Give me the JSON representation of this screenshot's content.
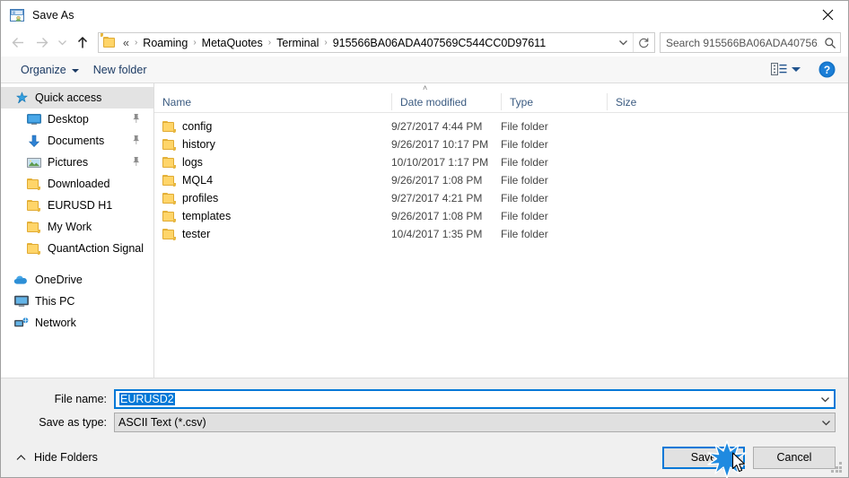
{
  "window": {
    "title": "Save As",
    "icon": "save-as-icon",
    "close_label": "Close"
  },
  "nav": {
    "back": "back-arrow-icon",
    "forward": "forward-arrow-icon",
    "recent": "recent-locations-icon",
    "up": "up-arrow-icon"
  },
  "address": {
    "folder_icon": "folder-icon",
    "prefix": "«",
    "crumbs": [
      "Roaming",
      "MetaQuotes",
      "Terminal",
      "915566BA06ADA407569C544CC0D97611"
    ],
    "separator": "›",
    "dropdown_icon": "chevron-down-icon",
    "refresh_icon": "refresh-icon"
  },
  "search": {
    "placeholder": "Search 915566BA06ADA40756...",
    "value": "",
    "icon": "search-icon"
  },
  "toolbar": {
    "organize_label": "Organize",
    "new_folder_label": "New folder",
    "view_icon": "view-options-icon",
    "help_icon": "help-icon"
  },
  "sidebar": {
    "items": [
      {
        "label": "Quick access",
        "icon": "star-pin-icon",
        "selected": true,
        "indent": false,
        "pinned": false
      },
      {
        "label": "Desktop",
        "icon": "desktop-icon",
        "selected": false,
        "indent": true,
        "pinned": true
      },
      {
        "label": "Documents",
        "icon": "documents-icon",
        "selected": false,
        "indent": true,
        "pinned": true
      },
      {
        "label": "Pictures",
        "icon": "pictures-icon",
        "selected": false,
        "indent": true,
        "pinned": true
      },
      {
        "label": "Downloaded",
        "icon": "folder-icon",
        "selected": false,
        "indent": true,
        "pinned": false
      },
      {
        "label": "EURUSD H1",
        "icon": "folder-icon",
        "selected": false,
        "indent": true,
        "pinned": false
      },
      {
        "label": "My Work",
        "icon": "folder-icon",
        "selected": false,
        "indent": true,
        "pinned": false
      },
      {
        "label": "QuantAction Signal",
        "icon": "folder-icon",
        "selected": false,
        "indent": true,
        "pinned": false
      }
    ],
    "items2": [
      {
        "label": "OneDrive",
        "icon": "onedrive-icon"
      },
      {
        "label": "This PC",
        "icon": "this-pc-icon"
      },
      {
        "label": "Network",
        "icon": "network-icon"
      }
    ]
  },
  "filelist": {
    "columns": [
      "Name",
      "Date modified",
      "Type",
      "Size"
    ],
    "sort_indicator": "˄",
    "rows": [
      {
        "name": "config",
        "date": "9/27/2017 4:44 PM",
        "type": "File folder",
        "size": ""
      },
      {
        "name": "history",
        "date": "9/26/2017 10:17 PM",
        "type": "File folder",
        "size": ""
      },
      {
        "name": "logs",
        "date": "10/10/2017 1:17 PM",
        "type": "File folder",
        "size": ""
      },
      {
        "name": "MQL4",
        "date": "9/26/2017 1:08 PM",
        "type": "File folder",
        "size": ""
      },
      {
        "name": "profiles",
        "date": "9/27/2017 4:21 PM",
        "type": "File folder",
        "size": ""
      },
      {
        "name": "templates",
        "date": "9/26/2017 1:08 PM",
        "type": "File folder",
        "size": ""
      },
      {
        "name": "tester",
        "date": "10/4/2017 1:35 PM",
        "type": "File folder",
        "size": ""
      }
    ]
  },
  "form": {
    "filename_label": "File name:",
    "filename_value": "EURUSD2",
    "filetype_label": "Save as type:",
    "filetype_value": "ASCII Text (*.csv)",
    "dropdown_icon": "chevron-down-icon"
  },
  "actions": {
    "hide_folders_label": "Hide Folders",
    "hide_folders_icon": "chevron-up-icon",
    "save_label": "Save",
    "cancel_label": "Cancel"
  },
  "colors": {
    "accent": "#0078d7",
    "folder": "#ffd569",
    "toolbar_text": "#1b3a63",
    "header_text": "#3a5a80"
  }
}
